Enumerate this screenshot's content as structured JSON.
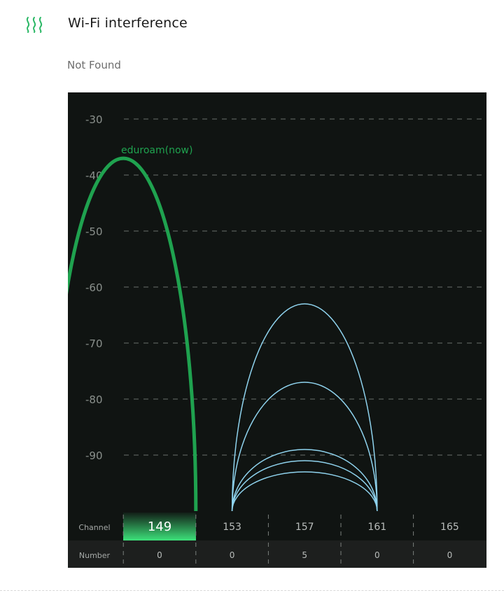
{
  "header": {
    "title": "Wi-Fi interference",
    "icon": "heat-waves-icon",
    "icon_color": "#2bb866"
  },
  "status": "Not Found",
  "chart_data": {
    "type": "area",
    "ylim": [
      -100,
      -25
    ],
    "y_ticks": [
      -30,
      -40,
      -50,
      -60,
      -70,
      -80,
      -90
    ],
    "grid": "horizontal dashed",
    "channels": [
      149,
      153,
      157,
      161,
      165
    ],
    "row_labels": {
      "channel": "Channel",
      "number": "Number"
    },
    "numbers": [
      0,
      0,
      5,
      0,
      0
    ],
    "selected_channel": 149,
    "series": [
      {
        "name": "eduroam(now)",
        "label": "eduroam(now)",
        "center_channel": 147,
        "width_channels": 8,
        "peak": -37,
        "highlight": true
      },
      {
        "center_channel": 157,
        "width_channels": 8,
        "peak": -63
      },
      {
        "center_channel": 157,
        "width_channels": 8,
        "peak": -77
      },
      {
        "center_channel": 157,
        "width_channels": 8,
        "peak": -89
      },
      {
        "center_channel": 157,
        "width_channels": 8,
        "peak": -91
      },
      {
        "center_channel": 157,
        "width_channels": 8,
        "peak": -93
      }
    ],
    "colors": {
      "background": "#101412",
      "grid": "#6a6f6c",
      "tick_label": "#8a908c",
      "highlight": "#1fa24f",
      "series": "#8fd3ee",
      "selected_bg": "#3de17a",
      "row_bg": "#1d1f1e"
    }
  }
}
